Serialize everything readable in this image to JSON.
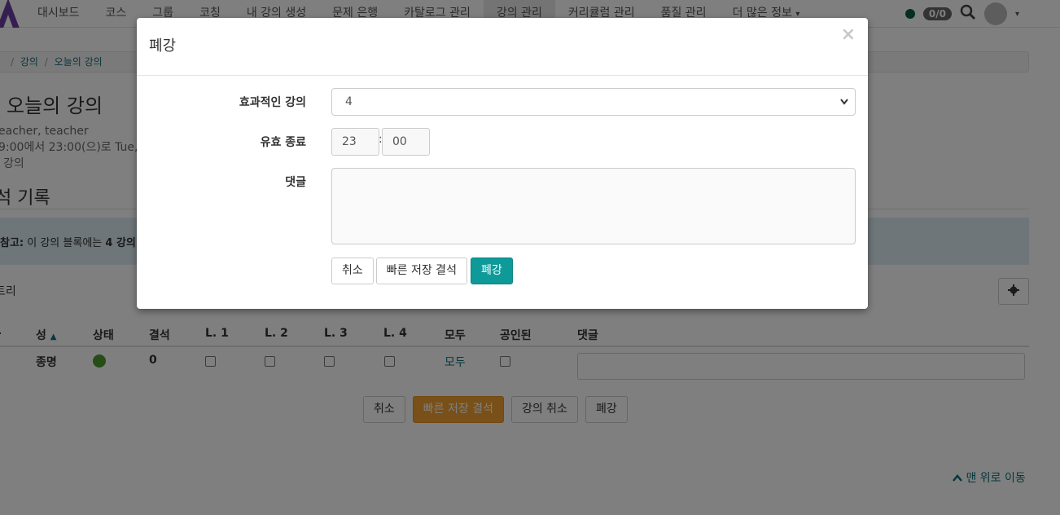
{
  "nav": {
    "items": [
      "대시보드",
      "코스",
      "그룹",
      "코칭",
      "내 강의 생성",
      "문제 은행",
      "카탈로그 관리",
      "강의 관리",
      "커리큘럼 관리",
      "품질 관리",
      "더 많은 정보"
    ],
    "more_caret": "▾",
    "count_badge": "0/0",
    "status_color": "#0f5f3a"
  },
  "breadcrumb": [
    "강의",
    "오늘의 강의"
  ],
  "page": {
    "title": "오늘의 강의",
    "meta_line1": "eacher, teacher",
    "meta_line2": "9:00에서 23:00(으)로 Tue, 2",
    "meta_line3": "강의",
    "section_title": "석 기록",
    "alert_label": "참고:",
    "alert_text": " 이 강의 블록에는 ",
    "alert_bold": "4 강의",
    "entries_label": "트리"
  },
  "table": {
    "headers": [
      "성",
      "상태",
      "결석",
      "L. 1",
      "L. 2",
      "L. 3",
      "L. 4",
      "모두",
      "공인된",
      "댓글"
    ],
    "sort_indicator": "▲",
    "row": {
      "name": "종명",
      "absences": "0",
      "all_link": "모두"
    }
  },
  "bottom_buttons": {
    "cancel": "취소",
    "quick_save": "빠른 저장 결석",
    "cancel_lecture": "강의 취소",
    "close_lecture": "폐강"
  },
  "back_to_top": "맨 위로 이동",
  "modal": {
    "title": "폐강",
    "effective_label": "효과적인 강의",
    "effective_value": "4",
    "valid_end_label": "유효 종료",
    "hour": "23",
    "minute": "00",
    "time_sep": ":",
    "comment_label": "댓글",
    "cancel": "취소",
    "quick_save": "빠른 저장 결석",
    "submit": "폐강"
  },
  "colors": {
    "accent": "#0f9a9a",
    "warning": "#f0a030",
    "link": "#0f6e7a"
  }
}
